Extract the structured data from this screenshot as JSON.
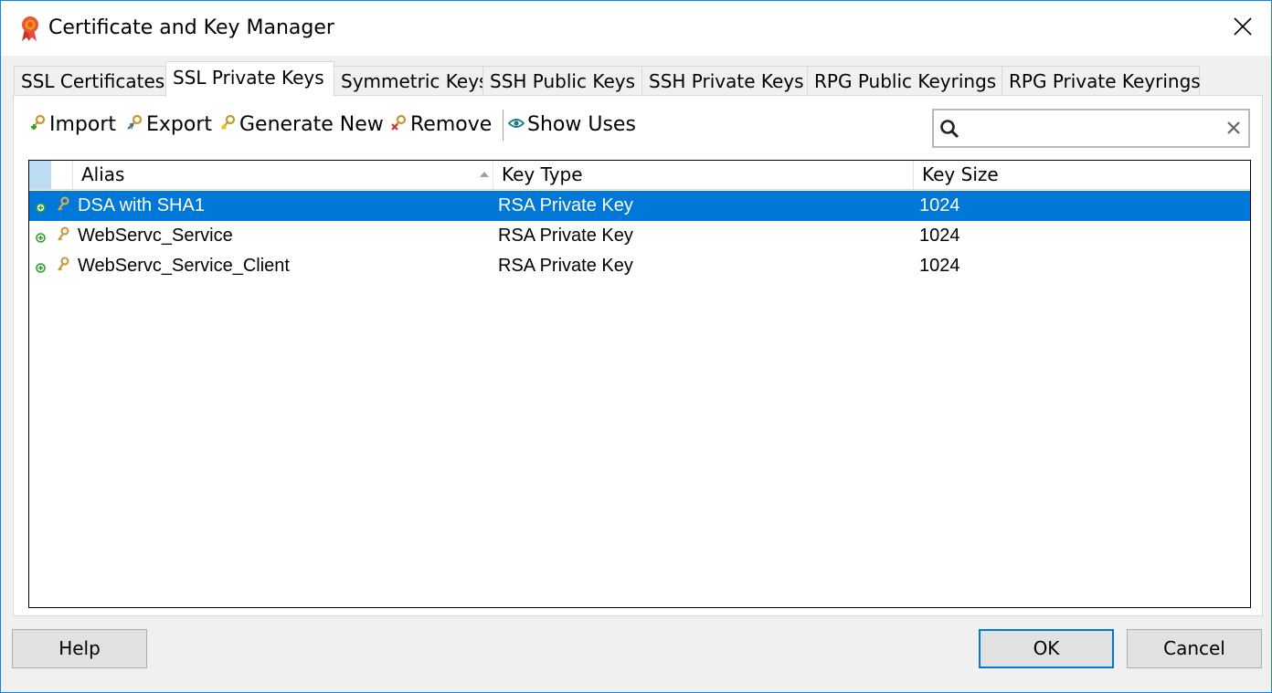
{
  "window": {
    "title": "Certificate and Key Manager",
    "app_icon": "ribbon-seal-icon",
    "close_icon": "close-icon"
  },
  "tabs": [
    {
      "label": "SSL Certificates",
      "active": false
    },
    {
      "label": "SSL Private Keys",
      "active": true
    },
    {
      "label": "Symmetric Keys",
      "active": false
    },
    {
      "label": "SSH Public Keys",
      "active": false
    },
    {
      "label": "SSH Private Keys",
      "active": false
    },
    {
      "label": "RPG Public Keyrings",
      "active": false
    },
    {
      "label": "RPG Private Keyrings",
      "active": false
    }
  ],
  "toolbar": {
    "import_label": "Import",
    "export_label": "Export",
    "generate_label": "Generate New",
    "remove_label": "Remove",
    "show_uses_label": "Show Uses"
  },
  "search": {
    "value": "",
    "placeholder": ""
  },
  "table": {
    "columns": [
      "Alias",
      "Key Type",
      "Key Size"
    ],
    "sort_column": "Alias",
    "sort_direction": "ascending",
    "rows": [
      {
        "alias": "DSA with SHA1",
        "key_type": "RSA Private Key",
        "key_size": "1024",
        "selected": true
      },
      {
        "alias": "WebServc_Service",
        "key_type": "RSA Private Key",
        "key_size": "1024",
        "selected": false
      },
      {
        "alias": "WebServc_Service_Client",
        "key_type": "RSA Private Key",
        "key_size": "1024",
        "selected": false
      }
    ]
  },
  "buttons": {
    "help": "Help",
    "ok": "OK",
    "cancel": "Cancel"
  },
  "colors": {
    "accent": "#0078d7",
    "selected_row_bg": "#0078d7",
    "window_border": "#1883d7",
    "key_icon": "#c8962e",
    "expand_icon": "#2e9e2e",
    "remove_x": "#d03030"
  }
}
